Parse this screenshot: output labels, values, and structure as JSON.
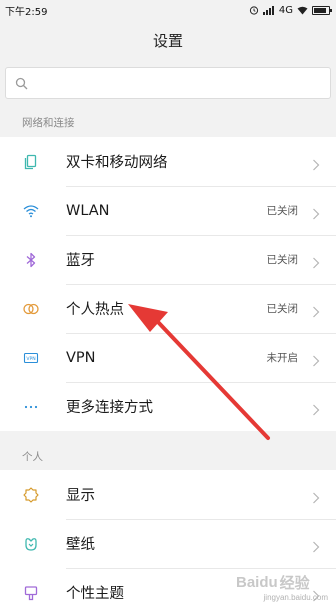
{
  "status_bar": {
    "time": "下午2:59",
    "network": "4G"
  },
  "header": {
    "title": "设置"
  },
  "search": {
    "placeholder": ""
  },
  "sections": {
    "network": {
      "label": "网络和连接",
      "items": [
        {
          "label": "双卡和移动网络",
          "status": "",
          "icon": "sim-card-icon"
        },
        {
          "label": "WLAN",
          "status": "已关闭",
          "icon": "wifi-icon"
        },
        {
          "label": "蓝牙",
          "status": "已关闭",
          "icon": "bluetooth-icon"
        },
        {
          "label": "个人热点",
          "status": "已关闭",
          "icon": "hotspot-icon"
        },
        {
          "label": "VPN",
          "status": "未开启",
          "icon": "vpn-icon"
        },
        {
          "label": "更多连接方式",
          "status": "",
          "icon": "more-dots-icon"
        }
      ]
    },
    "personal": {
      "label": "个人",
      "items": [
        {
          "label": "显示",
          "status": "",
          "icon": "display-icon"
        },
        {
          "label": "壁纸",
          "status": "",
          "icon": "wallpaper-icon"
        },
        {
          "label": "个性主题",
          "status": "",
          "icon": "theme-icon"
        }
      ]
    }
  },
  "colors": {
    "icon_teal": "#3fb8af",
    "icon_blue": "#2b8fd9",
    "icon_purple": "#a06ad8",
    "icon_orange": "#e39a3a",
    "icon_gold": "#d69a2b",
    "arrow_red": "#e53935"
  },
  "watermark": {
    "brand": "Baidu",
    "text": "经验",
    "sub": "jingyan.baidu.com"
  }
}
